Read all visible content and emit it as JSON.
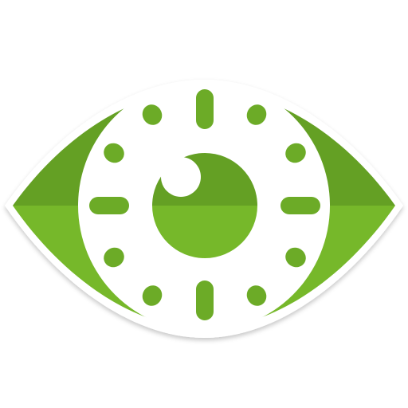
{
  "app_icon": {
    "icon": "eye-clock-icon",
    "colors": {
      "background": "#ffffff",
      "green_light": "#76b82a",
      "green_dark": "#64a024",
      "iris_white": "#ffffff",
      "outline_shadow": "#d9d9d9"
    }
  }
}
